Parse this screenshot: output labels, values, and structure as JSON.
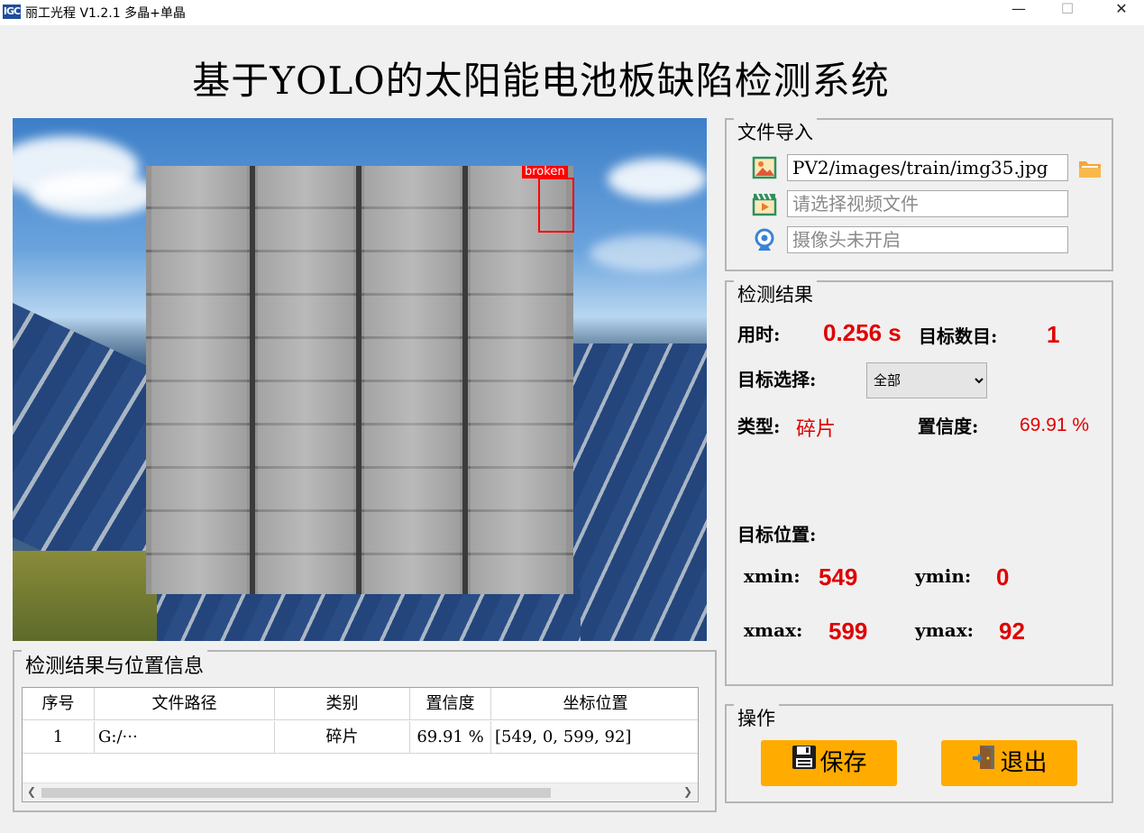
{
  "window": {
    "icon_text": "IGC",
    "title": "丽工光程 V1.2.1 多晶+单晶",
    "minimize": "—",
    "maximize": "☐",
    "close": "✕"
  },
  "heading": "基于YOLO的太阳能电池板缺陷检测系统",
  "image_panel": {
    "detection_label": "broken"
  },
  "file_import": {
    "title": "文件导入",
    "image_path": "PV2/images/train/img35.jpg",
    "video_placeholder": "请选择视频文件",
    "camera_placeholder": "摄像头未开启"
  },
  "results": {
    "title": "检测结果",
    "time_label": "用时:",
    "time_value": "0.256 s",
    "count_label": "目标数目:",
    "count_value": "1",
    "select_label": "目标选择:",
    "select_value": "全部",
    "type_label": "类型:",
    "type_value": "碎片",
    "confidence_label": "置信度:",
    "confidence_value": "69.91 %",
    "position_label": "目标位置:",
    "xmin_label": "xmin:",
    "xmin_value": "549",
    "ymin_label": "ymin:",
    "ymin_value": "0",
    "xmax_label": "xmax:",
    "xmax_value": "599",
    "ymax_label": "ymax:",
    "ymax_value": "92"
  },
  "table": {
    "title": "检测结果与位置信息",
    "headers": [
      "序号",
      "文件路径",
      "类别",
      "置信度",
      "坐标位置"
    ],
    "rows": [
      [
        "1",
        "G:/···",
        "碎片",
        "69.91 %",
        "[549, 0, 599, 92]"
      ]
    ]
  },
  "operations": {
    "title": "操作",
    "save_label": "保存",
    "exit_label": "退出"
  },
  "colors": {
    "accent_red": "#e00000",
    "button_orange": "#ffab00",
    "bbox_red": "#ff0000"
  },
  "icons": [
    "image-icon",
    "folder-icon",
    "video-icon",
    "camera-icon",
    "save-icon",
    "exit-icon"
  ]
}
